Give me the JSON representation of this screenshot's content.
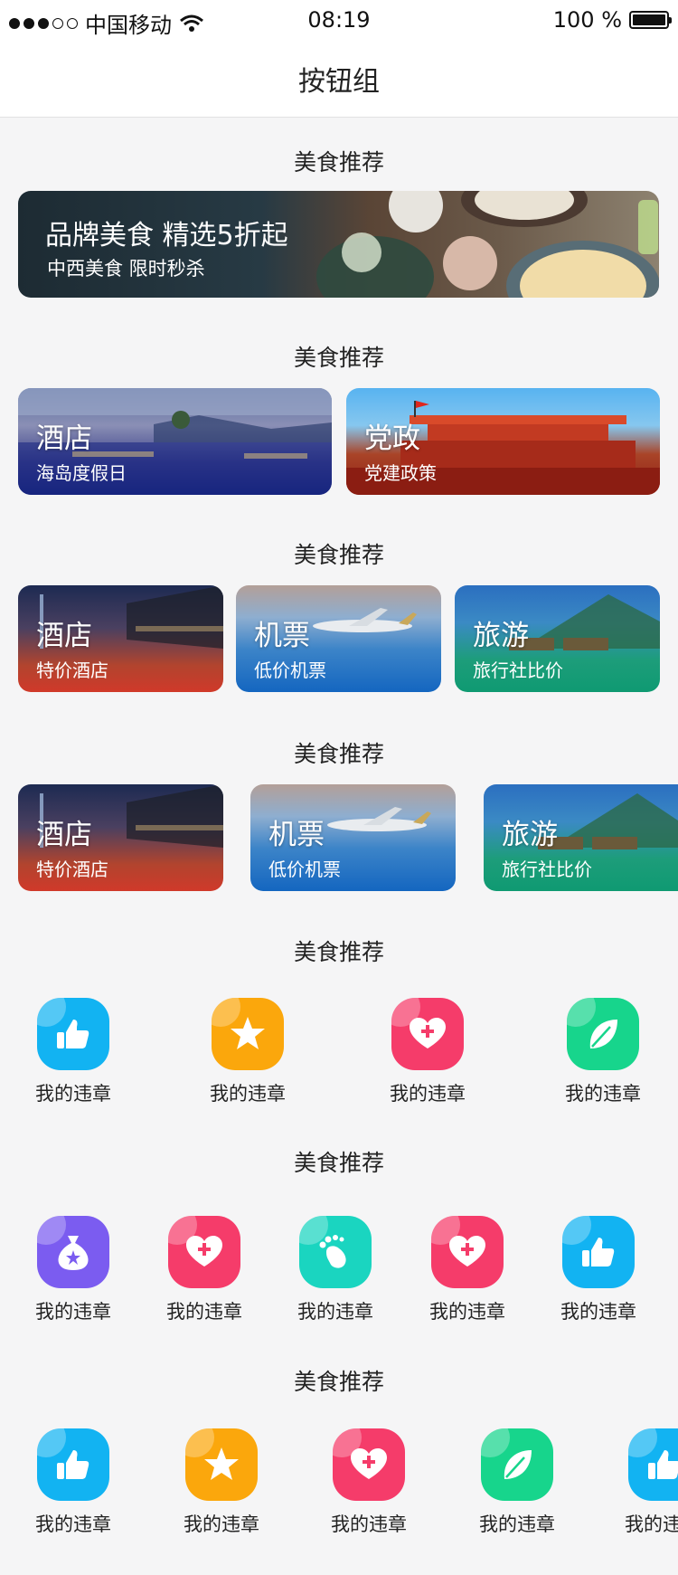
{
  "status_bar": {
    "carrier": "中国移动",
    "time": "08:19",
    "battery": "100 %"
  },
  "nav": {
    "title": "按钮组"
  },
  "sections": {
    "s1": {
      "title": "美食推荐"
    },
    "s2": {
      "title": "美食推荐"
    },
    "s3": {
      "title": "美食推荐"
    },
    "s4": {
      "title": "美食推荐"
    },
    "s5": {
      "title": "美食推荐"
    },
    "s6": {
      "title": "美食推荐"
    },
    "s7": {
      "title": "美食推荐"
    }
  },
  "banner": {
    "title": "品牌美食 精选5折起",
    "subtitle": "中西美食 限时秒杀"
  },
  "two_cards": [
    {
      "title": "酒店",
      "subtitle": "海岛度假日"
    },
    {
      "title": "党政",
      "subtitle": "党建政策"
    }
  ],
  "three_cards": [
    {
      "title": "酒店",
      "subtitle": "特价酒店"
    },
    {
      "title": "机票",
      "subtitle": "低价机票"
    },
    {
      "title": "旅游",
      "subtitle": "旅行社比价"
    }
  ],
  "scroll_cards": [
    {
      "title": "酒店",
      "subtitle": "特价酒店"
    },
    {
      "title": "机票",
      "subtitle": "低价机票"
    },
    {
      "title": "旅游",
      "subtitle": "旅行社比价"
    }
  ],
  "icon_row1": [
    {
      "label": "我的违章",
      "icon": "thumbs-up-icon",
      "color": "#12b3f2"
    },
    {
      "label": "我的违章",
      "icon": "star-icon",
      "color": "#fba70c"
    },
    {
      "label": "我的违章",
      "icon": "heart-plus-icon",
      "color": "#f53c6a"
    },
    {
      "label": "我的违章",
      "icon": "leaf-icon",
      "color": "#17d58c"
    }
  ],
  "icon_row2": [
    {
      "label": "我的违章",
      "icon": "money-bag-icon",
      "color": "#7b5cf0"
    },
    {
      "label": "我的违章",
      "icon": "heart-plus-icon",
      "color": "#f53c6a"
    },
    {
      "label": "我的违章",
      "icon": "footprint-icon",
      "color": "#1ad5c0"
    },
    {
      "label": "我的违章",
      "icon": "heart-plus-icon",
      "color": "#f53c6a"
    },
    {
      "label": "我的违章",
      "icon": "thumbs-up-icon",
      "color": "#12b3f2"
    }
  ],
  "icon_row3": [
    {
      "label": "我的违章",
      "icon": "thumbs-up-icon",
      "color": "#12b3f2"
    },
    {
      "label": "我的违章",
      "icon": "star-icon",
      "color": "#fba70c"
    },
    {
      "label": "我的违章",
      "icon": "heart-plus-icon",
      "color": "#f53c6a"
    },
    {
      "label": "我的违章",
      "icon": "leaf-icon",
      "color": "#17d58c"
    },
    {
      "label": "我的违章",
      "icon": "thumbs-up-icon",
      "color": "#12b3f2"
    }
  ]
}
